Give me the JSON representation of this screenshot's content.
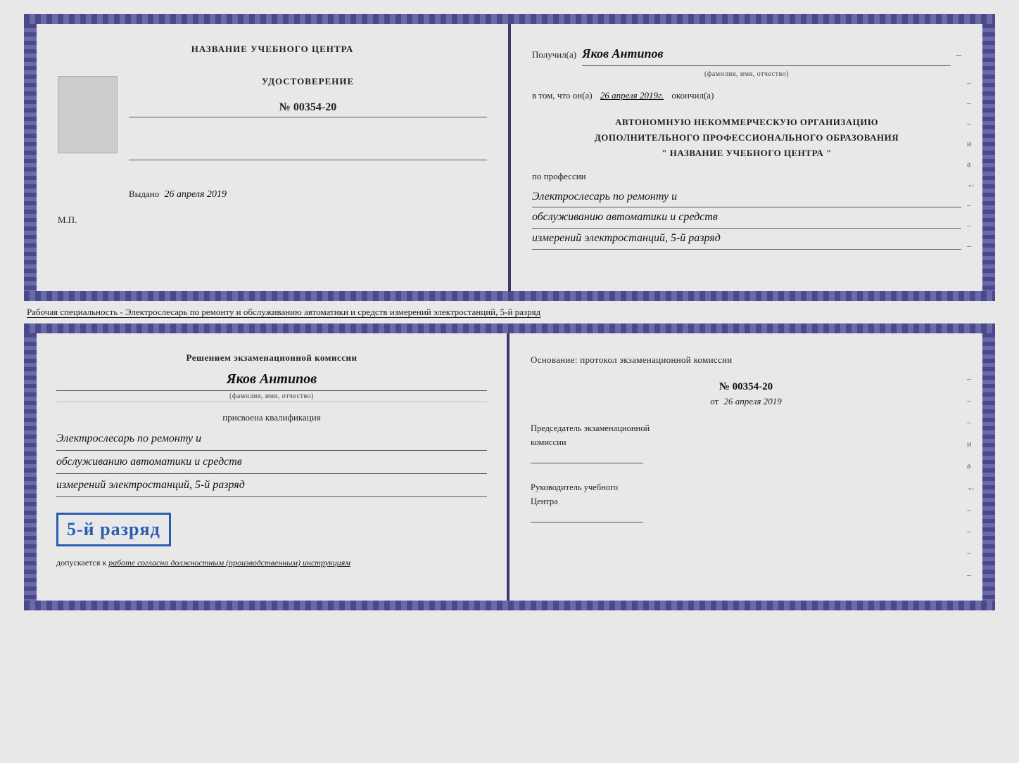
{
  "top_doc": {
    "left_page": {
      "center_label": "НАЗВАНИЕ УЧЕБНОГО ЦЕНТРА",
      "cert_type": "УДОСТОВЕРЕНИЕ",
      "cert_number": "№ 00354-20",
      "issued_label": "Выдано",
      "issued_date": "26 апреля 2019",
      "mp_label": "М.П."
    },
    "right_page": {
      "recipient_prefix": "Получил(а)",
      "recipient_name": "Яков Антипов",
      "name_subtitle": "(фамилия, имя, отчество)",
      "date_prefix": "в том, что он(а)",
      "date_value": "26 апреля 2019г.",
      "date_suffix": "окончил(а)",
      "org_line1": "АВТОНОМНУЮ НЕКОММЕРЧЕСКУЮ ОРГАНИЗАЦИЮ",
      "org_line2": "ДОПОЛНИТЕЛЬНОГО ПРОФЕССИОНАЛЬНОГО ОБРАЗОВАНИЯ",
      "org_quote_open": "\"",
      "org_name": "НАЗВАНИЕ УЧЕБНОГО ЦЕНТРА",
      "org_quote_close": "\"",
      "profession_prefix": "по профессии",
      "profession_line1": "Электрослесарь по ремонту и",
      "profession_line2": "обслуживанию автоматики и средств",
      "profession_line3": "измерений электростанций, 5-й разряд",
      "side_marks": [
        "–",
        "–",
        "–",
        "и",
        "а",
        "←",
        "–",
        "–",
        "–"
      ]
    }
  },
  "info_text": "Рабочая специальность - Электрослесарь по ремонту и обслуживанию автоматики и средств измерений электростанций, 5-й разряд",
  "bottom_doc": {
    "left_page": {
      "decision_line1": "Решением экзаменационной комиссии",
      "person_name": "Яков Антипов",
      "name_subtitle": "(фамилия, имя, отчество)",
      "qual_prefix": "присвоена квалификация",
      "qual_line1": "Электрослесарь по ремонту и",
      "qual_line2": "обслуживанию автоматики и средств",
      "qual_line3": "измерений электростанций, 5-й разряд",
      "rank_text": "5-й разряд",
      "допускается_prefix": "допускается к",
      "допускается_italic": "работе согласно должностным (производственным) инструкциям"
    },
    "right_page": {
      "basis_line1": "Основание: протокол экзаменационной комиссии",
      "basis_number": "№ 00354-20",
      "basis_date_prefix": "от",
      "basis_date": "26 апреля 2019",
      "chairman_line1": "Председатель экзаменационной",
      "chairman_line2": "комиссии",
      "head_line1": "Руководитель учебного",
      "head_line2": "Центра",
      "side_marks": [
        "–",
        "–",
        "–",
        "и",
        "а",
        "←",
        "–",
        "–",
        "–",
        "–"
      ]
    }
  }
}
